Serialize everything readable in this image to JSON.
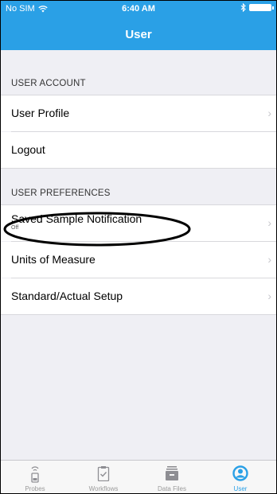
{
  "status": {
    "carrier": "No SIM",
    "time": "6:40 AM"
  },
  "header": {
    "title": "User"
  },
  "sections": [
    {
      "header": "USER ACCOUNT",
      "items": [
        {
          "label": "User Profile",
          "chevron": true
        },
        {
          "label": "Logout",
          "chevron": false
        }
      ]
    },
    {
      "header": "USER PREFERENCES",
      "items": [
        {
          "label": "Saved Sample Notification",
          "sub": "Off",
          "chevron": true
        },
        {
          "label": "Units of Measure",
          "chevron": true
        },
        {
          "label": "Standard/Actual Setup",
          "chevron": true
        }
      ]
    }
  ],
  "tabs": [
    {
      "label": "Probes",
      "icon": "probe-icon"
    },
    {
      "label": "Workflows",
      "icon": "clipboard-icon"
    },
    {
      "label": "Data Files",
      "icon": "data-files-icon"
    },
    {
      "label": "User",
      "icon": "user-icon",
      "active": true
    }
  ],
  "colors": {
    "accent": "#2aa0e6",
    "background": "#efeff4"
  }
}
